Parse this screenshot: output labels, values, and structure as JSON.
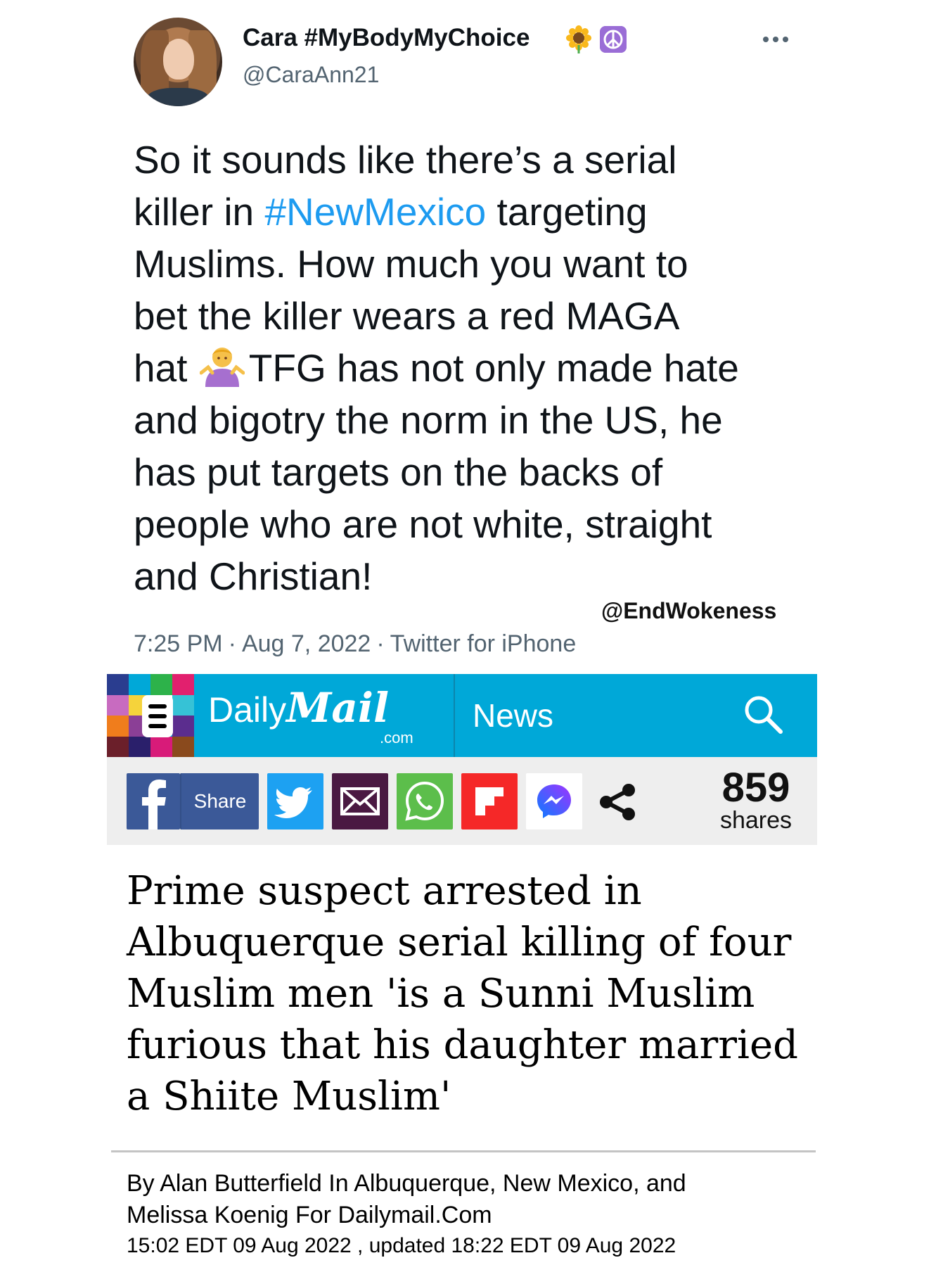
{
  "tweet": {
    "display_name": "Cara #MyBodyMyChoice",
    "badges": [
      "sunflower-emoji",
      "peace-symbol-emoji"
    ],
    "handle": "@CaraAnn21",
    "text_lines": [
      {
        "before": "So it sounds like there’s a serial",
        "link": "",
        "after": ""
      },
      {
        "before": "killer in ",
        "link": "#NewMexico",
        "after": " targeting"
      },
      {
        "before": "Muslims. How much you want to",
        "link": "",
        "after": ""
      },
      {
        "before": "bet the killer wears a red MAGA",
        "link": "",
        "after": ""
      },
      {
        "before": "hat ",
        "emoji": "person-shrugging-emoji",
        "after": "TFG has not only made hate"
      },
      {
        "before": "and bigotry the norm in the US, he",
        "link": "",
        "after": ""
      },
      {
        "before": "has put targets on the backs of",
        "link": "",
        "after": ""
      },
      {
        "before": "people who are not white, straight",
        "link": "",
        "after": ""
      },
      {
        "before": "and Christian!",
        "link": "",
        "after": ""
      }
    ],
    "time": "7:25 PM",
    "date": "Aug 7, 2022",
    "source": "Twitter for iPhone",
    "separator": "·"
  },
  "watermark": "@EndWokeness",
  "dailymail": {
    "logo_daily": "Daily",
    "logo_mail": "Mail",
    "logo_com": ".com",
    "section": "News",
    "brand_color": "#00a8d8"
  },
  "share_bar": {
    "share_label": "Share",
    "share_count": "859",
    "share_count_label": "shares",
    "buttons": [
      "facebook-icon",
      "twitter-icon",
      "email-icon",
      "whatsapp-icon",
      "flipboard-icon",
      "messenger-icon",
      "share-icon"
    ]
  },
  "article": {
    "headline_lines": [
      "Prime suspect arrested in",
      "Albuquerque serial killing of four",
      "Muslim men 'is a Sunni Muslim",
      "furious that his daughter married",
      "a Shiite Muslim'"
    ],
    "byline_lines": [
      "By Alan Butterfield In Albuquerque, New Mexico, and",
      "Melissa Koenig For Dailymail.Com"
    ],
    "dateline": "15:02 EDT 09 Aug 2022 , updated 18:22 EDT 09 Aug 2022"
  }
}
